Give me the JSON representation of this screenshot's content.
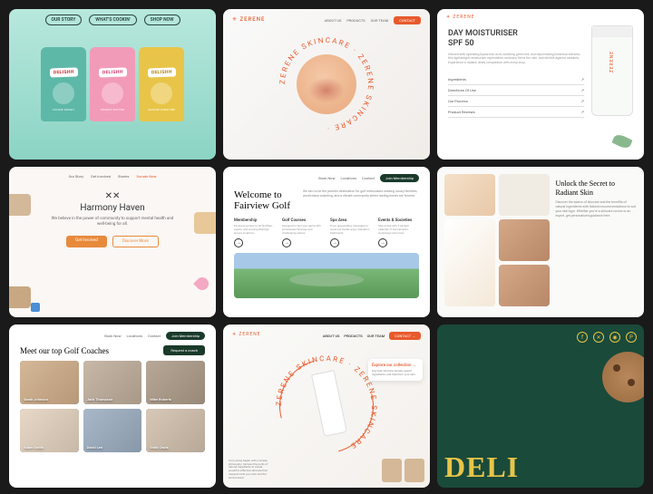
{
  "cards": {
    "delishh_pack": {
      "nav": [
        "OUR STORY",
        "WHAT'S COOKIN'",
        "SHOP NOW"
      ],
      "brand": "DELISHH",
      "flavors": [
        "COOKIE DOUGH",
        "PEANUT BUTTER",
        "ORANGE SUNSHINE"
      ]
    },
    "zerene_circ": {
      "logo": "✳ ZERENE",
      "nav": [
        "ABOUT US",
        "PRODUCTS",
        "OUR TEAM"
      ],
      "cta": "CONTACT",
      "ring_text": "ZERENE SKINCARE · ZERENE SKINCARE · "
    },
    "moisturiser": {
      "logo": "✳ ZERENE",
      "title": "DAY MOISTURISER\nSPF 50",
      "desc": "Infused with hydrating hyaluronic acid, soothing green tea, and rejuvenating botanical extracts, this lightweight moisturiser replenishes moisture, firms the skin, and shields against oxidants. Experience a radiant, dewy complexion with every drop.",
      "rows": [
        "Ingredients",
        "Directions Of Use",
        "Our Process",
        "Product Reviews"
      ],
      "tube_brand": "ZERENE"
    },
    "harmony": {
      "nav": [
        "Our Story",
        "Get Involved",
        "Stories",
        "Donate Now"
      ],
      "glyph": "✕✕",
      "title": "Harmony Haven",
      "body": "We believe in the power of community to support mental health and well-being for all.",
      "btn_primary": "Get Involved",
      "btn_secondary": "Discover More"
    },
    "fairview": {
      "nav": [
        "Book Now",
        "Locations",
        "Contact"
      ],
      "nav_cta": "Join Membership",
      "title": "Welcome to\nFairview Golf",
      "intro": "We aim to be the premier destination for golf enthusiasts seeking luxury facilities, world-class coaching, and a vibrant community where lasting bonds are formed.",
      "cols": [
        {
          "h": "Membership",
          "p": "Exclusive access to all facilities, events, and social gatherings across locations."
        },
        {
          "h": "Golf Courses",
          "p": "Designed to test your game with picturesque fairways and challenging greens."
        },
        {
          "h": "Spa Area",
          "p": "From rejuvenating massages to luxurious facials enjoy relaxation treatments."
        },
        {
          "h": "Events & Societies",
          "p": "Stay active with a packed calendar of tournaments, workshops and more."
        }
      ]
    },
    "radiant": {
      "title": "Unlock the Secret to\nRadiant Skin",
      "body": "Discover the basics of skincare and the benefits of natural ingredients with tailored recommendations to suit your skin type. Whether you're a skincare novice or an expert, get personalized guidance here."
    },
    "coaches": {
      "nav": [
        "Book Now",
        "Locations",
        "Contact"
      ],
      "nav_cta": "Join Membership",
      "title": "Meet our top Golf Coaches",
      "cta": "Request a coach",
      "list": [
        "Sarah Johnson",
        "Jack Thompson",
        "Mike Roberts",
        "Adam Smith",
        "David Lee",
        "Emily Davis"
      ]
    },
    "zerene_hero": {
      "logo": "✳ ZERENE",
      "nav": [
        "ABOUT US",
        "PRODUCTS",
        "OUR TEAM"
      ],
      "cta": "CONTACT →",
      "ring_text": "ZERENE SKINCARE · ZERENE SKINCARE",
      "callout_h": "Explore our collection →",
      "callout_p": "Discover skincare secrets, expert ingredients, and transform your skin.",
      "bottom_left": "Our journey began with a simple philosophy: harness the purity of natural ingredients to create powerful, effective skincare that respects both your skin and the environment."
    },
    "delishh_footer": {
      "social": [
        "f",
        "✕",
        "◉",
        "P"
      ],
      "big": "DELI"
    }
  }
}
